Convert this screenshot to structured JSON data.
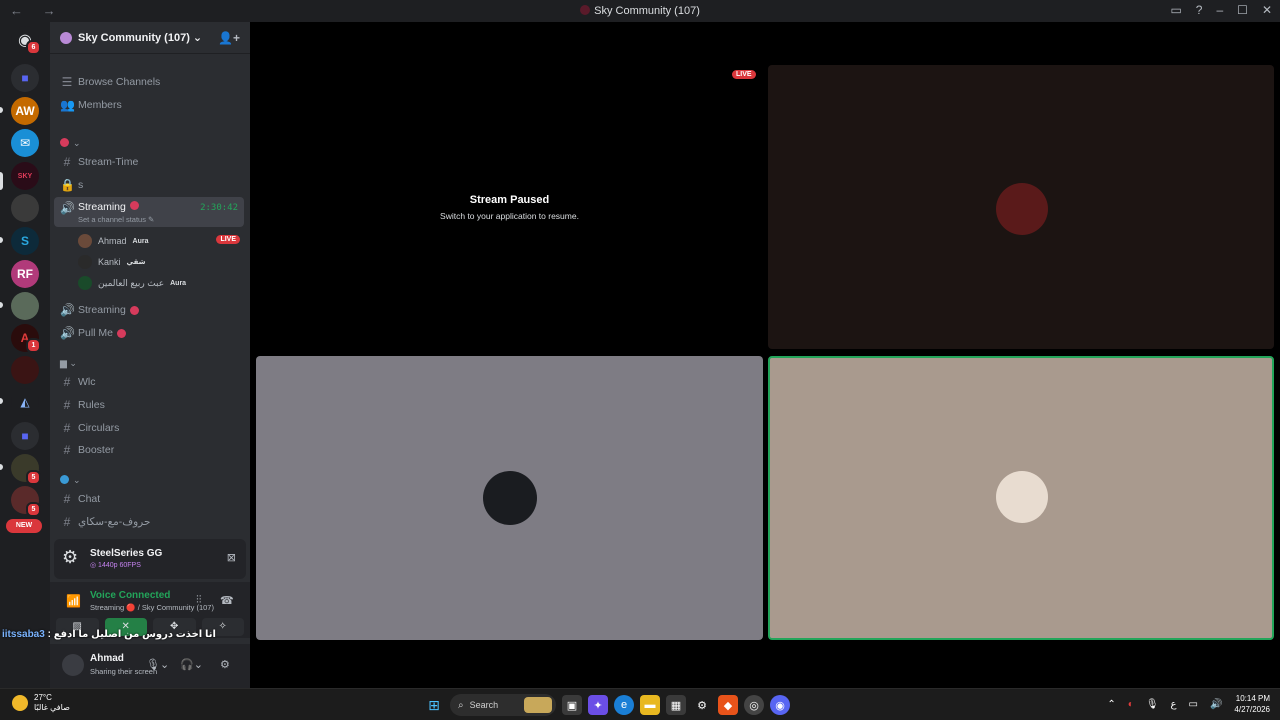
{
  "window": {
    "title": "Sky Community (107)",
    "nav": "← →"
  },
  "server": {
    "name": "Sky Community (107) ⌄"
  },
  "sidebar": {
    "browse": "Browse Channels",
    "members": "Members",
    "channels": [
      {
        "name": "Stream-Time"
      },
      {
        "name": "s"
      },
      {
        "name": "Streaming",
        "status": "Set a channel status ✎",
        "timer": "2:30:42"
      },
      {
        "name": "Streaming"
      },
      {
        "name": "Pull Me"
      },
      {
        "name": "Wlc"
      },
      {
        "name": "Rules"
      },
      {
        "name": "Circulars"
      },
      {
        "name": "Booster"
      },
      {
        "name": "Chat"
      },
      {
        "name": "حروف-مع-سكاي"
      }
    ],
    "voice_users": [
      {
        "name": "Ahmad",
        "tag": "Aura",
        "live": "LIVE"
      },
      {
        "name": "Kanki",
        "tag": "شقي"
      },
      {
        "name": "عبث ربيع العالمين",
        "tag": "Aura"
      }
    ]
  },
  "rail": {
    "badges": [
      "6",
      "1",
      "5",
      "5"
    ],
    "new_label": "NEW"
  },
  "steelseries": {
    "name": "SteelSeries GG",
    "sub": "◎ 1440p 60FPS"
  },
  "voice": {
    "status": "Voice Connected",
    "location": "Streaming 🔴 / Sky Community (107)"
  },
  "overlay": {
    "username": "iitssaba3",
    "message": " : انا اخذت دروس من اصليل ما ادفع"
  },
  "user": {
    "name": "Ahmad",
    "status": "Sharing their screen"
  },
  "stage": {
    "paused_title": "Stream Paused",
    "paused_sub": "Switch to your application to resume.",
    "live": "LIVE"
  },
  "taskbar": {
    "temp": "27°C",
    "weather": "صافي غالبًا",
    "search": "Search",
    "time": "10:14 PM",
    "date": "4/27/2026",
    "lang": "ع"
  },
  "colors": {
    "accent_green": "#23a55a",
    "live_red": "#da373c",
    "tile_gray": "#7e7c84",
    "tile_tan": "#a99a8e"
  }
}
